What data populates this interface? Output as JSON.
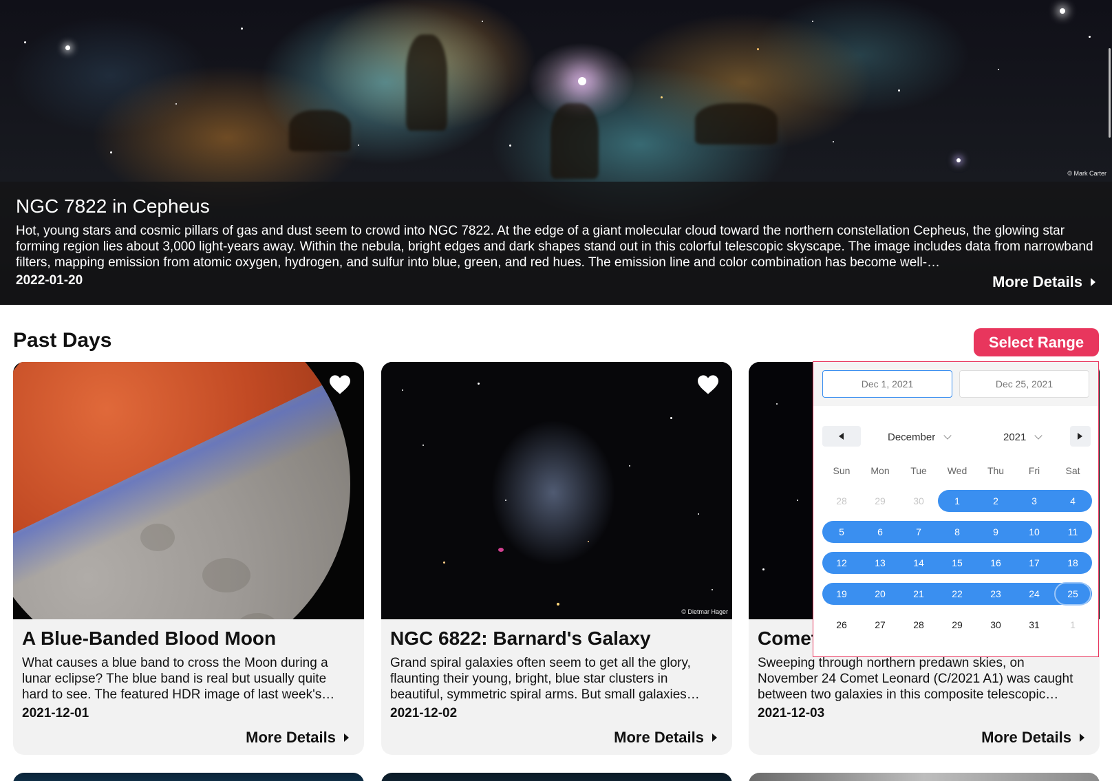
{
  "hero": {
    "title": "NGC 7822 in Cepheus",
    "description": "Hot, young stars and cosmic pillars of gas and dust seem to crowd into NGC 7822. At the edge of a giant molecular cloud toward the northern constellation Cepheus, the glowing star forming region lies about 3,000 light-years away. Within the nebula, bright edges and dark shapes stand out in this colorful telescopic skyscape. The image includes data from narrowband filters, mapping emission from atomic oxygen, hydrogen, and sulfur into blue, green, and red hues. The emission line and color combination has become well-…",
    "date": "2022-01-20",
    "more_label": "More Details",
    "credit": "© Mark Carter"
  },
  "section": {
    "title": "Past Days",
    "select_range_label": "Select Range"
  },
  "cards": [
    {
      "title": "A Blue-Banded Blood Moon",
      "description": "What causes a blue band to cross the Moon during a lunar eclipse? The blue band is real but usually quite hard to see. The featured HDR image of last week's…",
      "date": "2021-12-01",
      "more_label": "More Details",
      "favorite": true
    },
    {
      "title": "NGC 6822: Barnard's Galaxy",
      "description": "Grand spiral galaxies often seem to get all the glory, flaunting their young, bright, blue star clusters in beautiful, symmetric spiral arms. But small galaxies…",
      "date": "2021-12-02",
      "more_label": "More Details",
      "favorite": true,
      "credit": "© Dietmar Hager"
    },
    {
      "title": "Comet Leonard",
      "description": "Sweeping through northern predawn skies, on November 24 Comet Leonard (C/2021 A1) was caught between two galaxies in this composite telescopic…",
      "date": "2021-12-03",
      "more_label": "More Details",
      "favorite": false
    }
  ],
  "picker": {
    "start_value": "Dec 1, 2021",
    "end_value": "Dec 25, 2021",
    "month": "December",
    "year": "2021",
    "weekdays": [
      "Sun",
      "Mon",
      "Tue",
      "Wed",
      "Thu",
      "Fri",
      "Sat"
    ],
    "weeks": [
      [
        "28",
        "29",
        "30",
        "1",
        "2",
        "3",
        "4"
      ],
      [
        "5",
        "6",
        "7",
        "8",
        "9",
        "10",
        "11"
      ],
      [
        "12",
        "13",
        "14",
        "15",
        "16",
        "17",
        "18"
      ],
      [
        "19",
        "20",
        "21",
        "22",
        "23",
        "24",
        "25"
      ],
      [
        "26",
        "27",
        "28",
        "29",
        "30",
        "31",
        "1"
      ]
    ]
  },
  "colors": {
    "accent": "#e8365d",
    "range": "#3a8ff0"
  }
}
